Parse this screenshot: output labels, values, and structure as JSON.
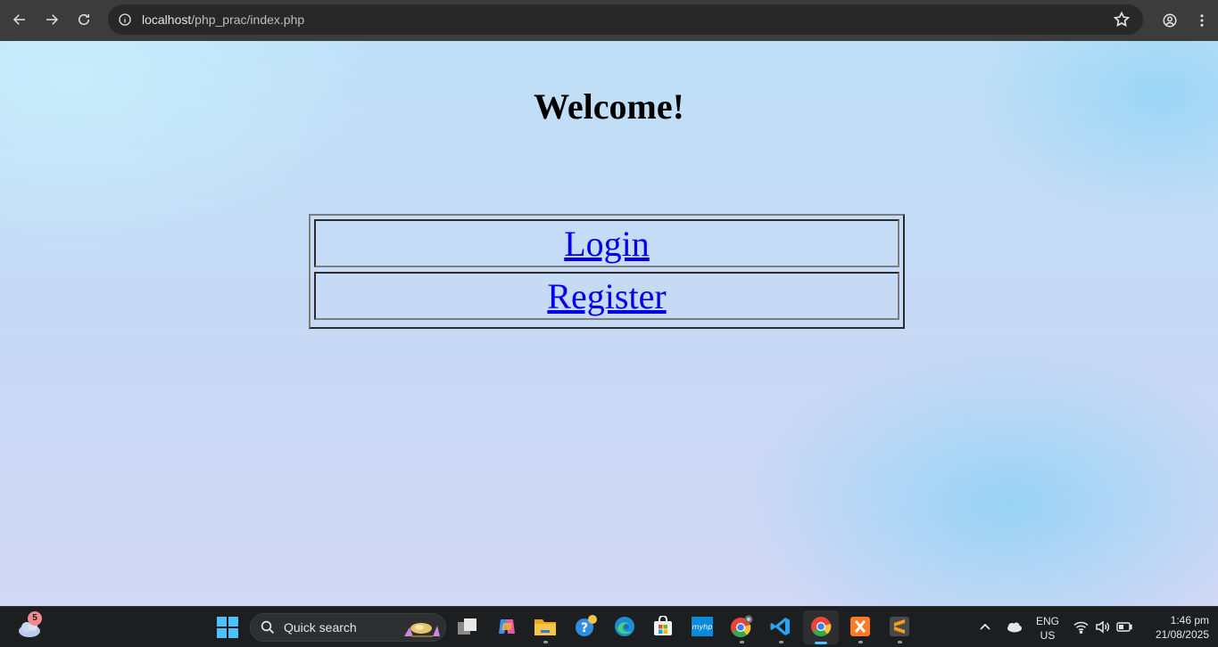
{
  "browser": {
    "url_host": "localhost",
    "url_path": "/php_prac/index.php",
    "icons": {
      "back": "arrow-left-icon",
      "forward": "arrow-right-icon",
      "reload": "reload-icon",
      "site_info": "info-icon",
      "bookmark": "star-icon",
      "profile": "profile-icon",
      "menu": "kebab-menu-icon"
    }
  },
  "page": {
    "heading": "Welcome!",
    "links": [
      {
        "label": "Login"
      },
      {
        "label": "Register"
      }
    ],
    "link_color": "#0000ee"
  },
  "taskbar": {
    "weather_badge": "5",
    "search_placeholder": "Quick search",
    "pinned_apps": [
      "task-view-icon",
      "copilot-icon",
      "file-explorer-icon",
      "get-help-icon",
      "edge-icon",
      "ms-store-icon",
      "myhp-icon",
      "chrome-dev-icon",
      "vscode-icon",
      "chrome-icon",
      "xampp-icon",
      "sublime-text-icon"
    ],
    "language_line1": "ENG",
    "language_line2": "US",
    "time": "1:46 pm",
    "date": "21/08/2025",
    "accent_color": "#4cc2ff"
  }
}
